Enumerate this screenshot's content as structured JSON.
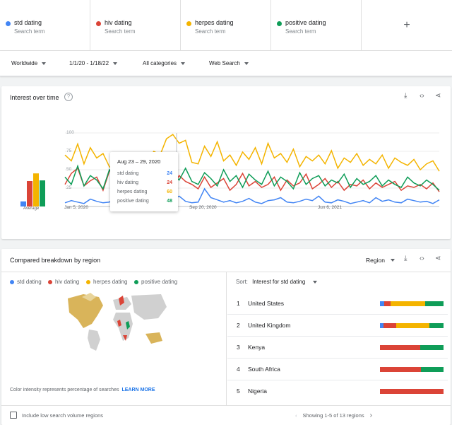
{
  "terms": [
    {
      "name": "std dating",
      "sub": "Search term",
      "color": "#4285f4"
    },
    {
      "name": "hiv dating",
      "sub": "Search term",
      "color": "#db4437"
    },
    {
      "name": "herpes dating",
      "sub": "Search term",
      "color": "#f4b400"
    },
    {
      "name": "positive dating",
      "sub": "Search term",
      "color": "#0f9d58"
    }
  ],
  "add_term": "+",
  "filters": {
    "location": "Worldwide",
    "date_range": "1/1/20 - 1/18/22",
    "category": "All categories",
    "search_type": "Web Search"
  },
  "interest": {
    "title": "Interest over time",
    "help": "?",
    "average_label": "Average",
    "averages": [
      8,
      40,
      52,
      41
    ],
    "x_ticks": [
      "Jan 5, 2020",
      "Sep 20, 2020",
      "Jun 6, 2021"
    ],
    "y_ticks": [
      "100",
      "75",
      "50",
      "25"
    ],
    "tooltip": {
      "title": "Aug 23 – 29, 2020",
      "rows": [
        {
          "label": "std dating",
          "value": "24"
        },
        {
          "label": "hiv dating",
          "value": "24"
        },
        {
          "label": "herpes dating",
          "value": "60"
        },
        {
          "label": "positive dating",
          "value": "48"
        }
      ]
    }
  },
  "chart_data": {
    "type": "line",
    "ylim": [
      0,
      100
    ],
    "x_range": [
      "Jan 5, 2020",
      "Jan 18, 2022"
    ],
    "series": [
      {
        "name": "std dating",
        "color": "#4285f4",
        "values": [
          5,
          8,
          6,
          4,
          10,
          7,
          5,
          6,
          12,
          8,
          6,
          4,
          24,
          18,
          10,
          8,
          6,
          9,
          14,
          7,
          5,
          6,
          24,
          12,
          9,
          6,
          8,
          5,
          7,
          11,
          6,
          4,
          8,
          9,
          12,
          6,
          5,
          7,
          10,
          8,
          14,
          6,
          5,
          9,
          7,
          4,
          6,
          8,
          5,
          12,
          7,
          9,
          6,
          5,
          10,
          8,
          6,
          7,
          4,
          9
        ]
      },
      {
        "name": "hiv dating",
        "color": "#db4437",
        "values": [
          30,
          45,
          52,
          28,
          35,
          40,
          22,
          48,
          55,
          32,
          30,
          26,
          38,
          44,
          24,
          50,
          36,
          28,
          42,
          34,
          30,
          24,
          40,
          26,
          32,
          38,
          22,
          30,
          45,
          28,
          34,
          26,
          30,
          40,
          22,
          36,
          28,
          32,
          44,
          24,
          30,
          38,
          26,
          34,
          22,
          30,
          28,
          36,
          24,
          32,
          26,
          30,
          34,
          22,
          28,
          26,
          30,
          24,
          32,
          20
        ]
      },
      {
        "name": "herpes dating",
        "color": "#f4b400",
        "values": [
          70,
          62,
          85,
          58,
          80,
          66,
          72,
          54,
          48,
          60,
          52,
          68,
          55,
          62,
          75,
          70,
          92,
          98,
          86,
          90,
          60,
          58,
          82,
          68,
          88,
          62,
          70,
          56,
          74,
          64,
          80,
          58,
          86,
          66,
          72,
          60,
          78,
          54,
          68,
          62,
          70,
          58,
          76,
          52,
          66,
          60,
          72,
          56,
          64,
          58,
          70,
          52,
          66,
          60,
          56,
          64,
          50,
          58,
          62,
          48
        ]
      },
      {
        "name": "positive dating",
        "color": "#0f9d58",
        "values": [
          40,
          30,
          55,
          28,
          42,
          36,
          24,
          50,
          38,
          30,
          44,
          26,
          48,
          42,
          32,
          60,
          28,
          44,
          36,
          52,
          34,
          30,
          46,
          38,
          28,
          50,
          34,
          42,
          26,
          44,
          36,
          30,
          48,
          28,
          40,
          34,
          24,
          46,
          30,
          38,
          42,
          28,
          36,
          32,
          44,
          26,
          38,
          30,
          34,
          42,
          28,
          36,
          30,
          26,
          40,
          32,
          28,
          36,
          30,
          22
        ]
      }
    ]
  },
  "region": {
    "title": "Compared breakdown by region",
    "select_label": "Region",
    "legend": [
      "std dating",
      "hiv dating",
      "herpes dating",
      "positive dating"
    ],
    "sort_label": "Sort:",
    "sort_value": "Interest for std dating",
    "rows": [
      {
        "rank": "1",
        "name": "United States",
        "shares": [
          7,
          10,
          54,
          29
        ]
      },
      {
        "rank": "2",
        "name": "United Kingdom",
        "shares": [
          5,
          21,
          52,
          22
        ]
      },
      {
        "rank": "3",
        "name": "Kenya",
        "shares": [
          0,
          63,
          0,
          37
        ]
      },
      {
        "rank": "4",
        "name": "South Africa",
        "shares": [
          0,
          64,
          0,
          36
        ]
      },
      {
        "rank": "5",
        "name": "Nigeria",
        "shares": [
          0,
          100,
          0,
          0
        ]
      }
    ],
    "map_note": "Color intensity represents percentage of searches",
    "learn_more": "LEARN MORE",
    "checkbox_label": "Include low search volume regions",
    "pager_text": "Showing 1-5 of 13 regions"
  }
}
